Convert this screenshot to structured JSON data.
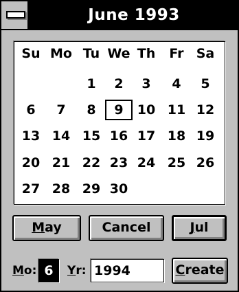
{
  "window": {
    "title": "June 1993"
  },
  "calendar": {
    "weekdays": [
      "Su",
      "Mo",
      "Tu",
      "We",
      "Th",
      "Fr",
      "Sa"
    ],
    "weeks": [
      [
        "",
        "",
        "1",
        "2",
        "3",
        "4",
        "5"
      ],
      [
        "6",
        "7",
        "8",
        "9",
        "10",
        "11",
        "12"
      ],
      [
        "13",
        "14",
        "15",
        "16",
        "17",
        "18",
        "19"
      ],
      [
        "20",
        "21",
        "22",
        "23",
        "24",
        "25",
        "26"
      ],
      [
        "27",
        "28",
        "29",
        "30",
        "",
        "",
        ""
      ]
    ],
    "selected_day": "9"
  },
  "buttons": {
    "prev_pre": "",
    "prev_key": "M",
    "prev_post": "ay",
    "cancel": "Cancel",
    "next_pre": "",
    "next_key": "J",
    "next_post": "ul",
    "create_pre": "",
    "create_key": "C",
    "create_post": "reate"
  },
  "form": {
    "month_label_key": "M",
    "month_label_rest": "o:",
    "month_value": "6",
    "year_label_key": "Y",
    "year_label_rest": "r:",
    "year_value": "1994"
  }
}
